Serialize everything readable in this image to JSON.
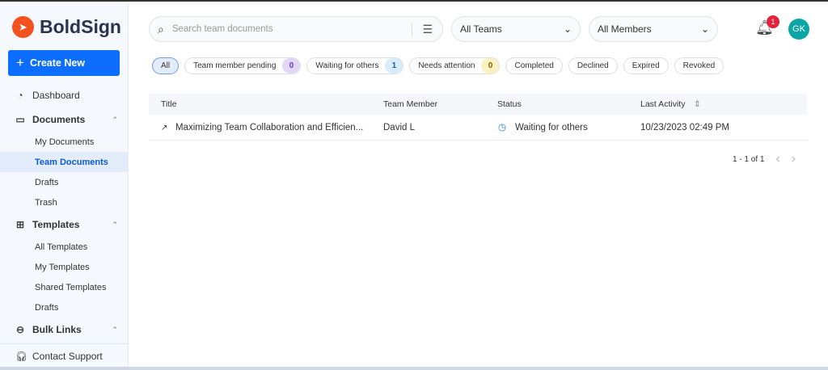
{
  "brand": {
    "name": "BoldSign"
  },
  "sidebar": {
    "create_label": "Create New",
    "dashboard": "Dashboard",
    "documents": "Documents",
    "documents_items": [
      "My Documents",
      "Team Documents",
      "Drafts",
      "Trash"
    ],
    "templates": "Templates",
    "templates_items": [
      "All Templates",
      "My Templates",
      "Shared Templates",
      "Drafts"
    ],
    "bulk_links": "Bulk Links",
    "support": "Contact Support"
  },
  "header": {
    "search_placeholder": "Search team documents",
    "teams": "All Teams",
    "members": "All Members",
    "notification_count": "1",
    "avatar": "GK"
  },
  "filters": [
    {
      "label": "All"
    },
    {
      "label": "Team member pending",
      "count": "0",
      "color": "#e4d6f7",
      "text": "#6a3dc2"
    },
    {
      "label": "Waiting for others",
      "count": "1",
      "color": "#d8ecfb",
      "text": "#1d5fa8"
    },
    {
      "label": "Needs attention",
      "count": "0",
      "color": "#fbf3bf",
      "text": "#7a6410"
    },
    {
      "label": "Completed"
    },
    {
      "label": "Declined"
    },
    {
      "label": "Expired"
    },
    {
      "label": "Revoked"
    }
  ],
  "table": {
    "columns": [
      "Title",
      "Team Member",
      "Status",
      "Last Activity"
    ],
    "rows": [
      {
        "title": "Maximizing Team Collaboration and Efficien...",
        "member": "David L",
        "status": "Waiting for others",
        "last_activity": "10/23/2023 02:49 PM"
      }
    ]
  },
  "pagination": {
    "text": "1 - 1 of 1"
  }
}
